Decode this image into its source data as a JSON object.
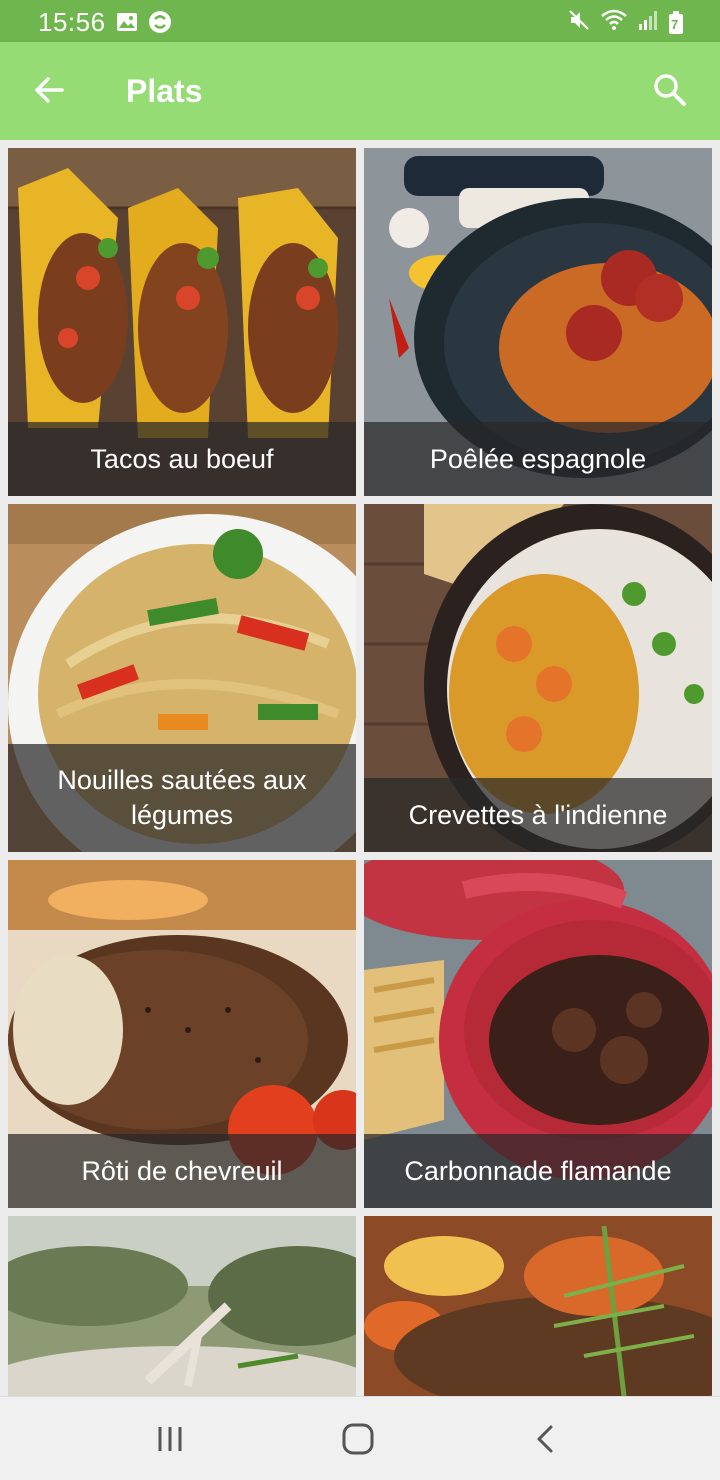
{
  "status_bar": {
    "time": "15:56",
    "left_icons": [
      "image-icon",
      "sync-app-icon"
    ],
    "right_icons": [
      "mute-icon",
      "wifi-icon",
      "signal-icon",
      "battery-icon"
    ],
    "battery_level": "7"
  },
  "app_bar": {
    "title": "Plats",
    "back_icon": "arrow-left-icon",
    "search_icon": "search-icon"
  },
  "dishes": [
    {
      "label": "Tacos au boeuf"
    },
    {
      "label": "Poêlée espagnole"
    },
    {
      "label": "Nouilles sautées aux légumes"
    },
    {
      "label": "Crevettes à l'indienne"
    },
    {
      "label": "Rôti de chevreuil"
    },
    {
      "label": "Carbonnade flamande"
    },
    {
      "label": ""
    },
    {
      "label": ""
    }
  ],
  "nav_bar": {
    "buttons": [
      "recent-apps-icon",
      "home-icon",
      "back-icon"
    ]
  },
  "colors": {
    "status_bar": "#6fb64e",
    "app_bar": "#94dc73",
    "caption_bg": "#282828"
  }
}
